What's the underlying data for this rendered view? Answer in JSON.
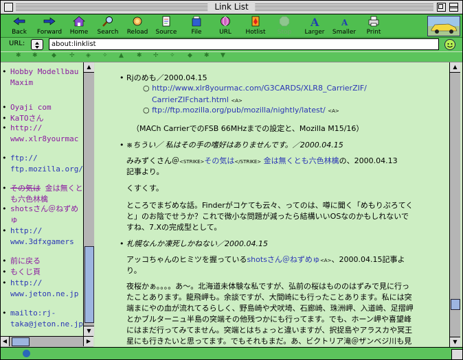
{
  "window": {
    "title": "Link List"
  },
  "toolbar": {
    "back": "Back",
    "forward": "Forward",
    "home": "Home",
    "search": "Search",
    "reload": "Reload",
    "source": "Source",
    "file": "File",
    "url": "URL",
    "hotlist": "Hotlist",
    "stop": "Stop",
    "larger": "Larger",
    "smaller": "Smaller",
    "print": "Print"
  },
  "urlbar": {
    "label": "URL:",
    "value": "about:linklist"
  },
  "sidebar": {
    "items": [
      {
        "text": "Hobby Modellbau Maxim"
      },
      {
        "text": "Oyaji com"
      },
      {
        "text": "KaTOさん"
      },
      {
        "text": "http:// www.xlr8yourmac"
      },
      {
        "text": "ftp:// ftp.mozilla.org/p"
      },
      {
        "strike": "その気は",
        "text": "金は無くとも六色林檎"
      },
      {
        "text": "shotsさん＠ねずめゅ"
      },
      {
        "text": "http:// www.3dfxgamers"
      },
      {
        "text": "前に戻る"
      },
      {
        "text": "もくじ頁"
      },
      {
        "text": "http:// www.jeton.ne.jp"
      },
      {
        "text": "mailto:rj-taka@jeton.ne.jp"
      }
    ]
  },
  "content": {
    "e1_title": "Rjのめも／2000.04.15",
    "e1_link1a": "http://www.xlr8yourmac.com/G3CARDS/XLR8_CarrierZIF/",
    "e1_link1b": "CarrierZIFchart.html",
    "e1_link2": "ftp://ftp.mozilla.org/pub/mozilla/nightly/latest/",
    "a_tag": "<A>",
    "e1_note": "（MACh CarrierでのFSB 66MHzまでの設定と、Mozilla M15/16）",
    "e2_title": "※ちうい／  私はその手の嗜好はありませんです。／2000.04.15",
    "e2_p1_pre": "みみずくさん＠",
    "strike_open": "<STRIKE>",
    "e2_p1_strike": "その気は",
    "strike_close": "</STRIKE>",
    "e2_p1_link": "金は無くとも六色林檎",
    "e2_p1_post": "の、2000.04.13",
    "e2_p1_line2": "記事より。",
    "e2_p2": "くすくす。",
    "e2_p3_l1": "ところでまぢめな話。Finderがコケても云々、ってのは、噂に聞く「めもりぷろてく",
    "e2_p3_l2": "と」のお陰でせうか？これで微小な問題が減ったら結構いいOSなのかもしれないで",
    "e2_p3_l3": "すね、7.Xの完成型として。",
    "e3_title": "札幌なんか凍死しかねない／2000.04.15",
    "e3_p1_pre": "アッコちゃんのヒミツを握っている",
    "e3_p1_link": "shotsさん＠ねずめゅ",
    "e3_p1_post": "、2000.04.15記事よ",
    "e3_p1_l2": "り。",
    "e3_p2_l1": "夜桜かぁ。。。。あ～。北海道未体験な私ですが、弘前の桜はもののはずみで見に行っ",
    "e3_p2_l2": "たことあります。龍飛岬も。余談ですが、大間崎にも行ったことあります。私には突",
    "e3_p2_l3": "端まにやの血が流れてるらしく、野島崎や犬吠埼、石廊崎、珠洲岬、入道崎、足摺岬",
    "e3_p2_l4": "とかブルターニュ半島の突端その他残つかにも行ってます。でも、ホーン岬や喜望峰",
    "e3_p2_l5": "にはまだ行ってみてません。突端とはちょっと違いますが、択捉島やアラスカや冥王",
    "e3_p2_l6": "星にも行きたいと思ってます。でもそれもまだ。あ、ビクトリア滝＠ザンベジ川も見"
  },
  "colors": {
    "background": "#cdeec3",
    "toolbar": "#4fbe4f",
    "link": "#2a35b5",
    "visited": "#8b1aa0"
  }
}
